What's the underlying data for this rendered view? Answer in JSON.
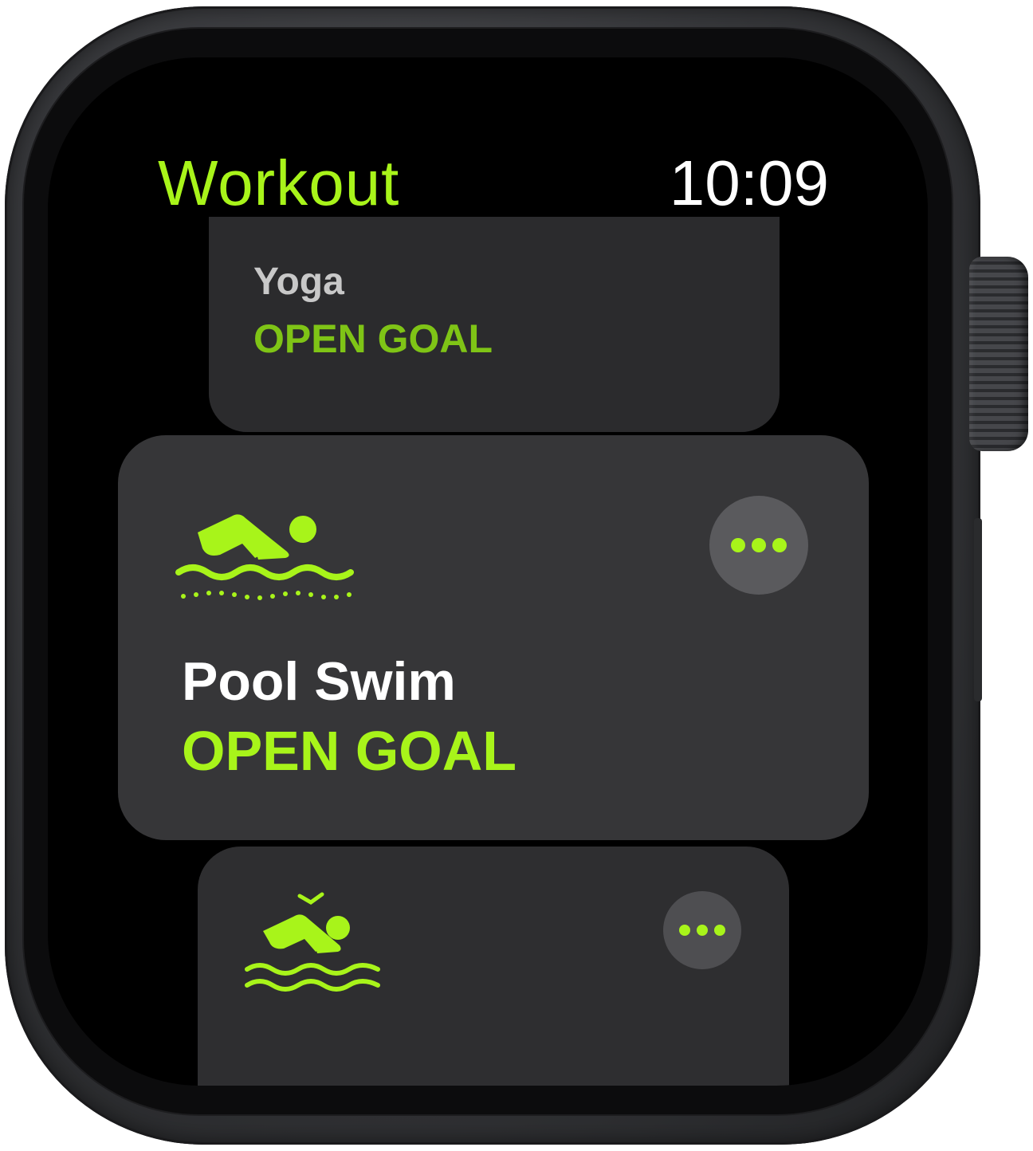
{
  "header": {
    "app_title": "Workout",
    "time": "10:09"
  },
  "workouts": [
    {
      "name": "Yoga",
      "goal": "OPEN GOAL",
      "icon": "yoga-icon"
    },
    {
      "name": "Pool Swim",
      "goal": "OPEN GOAL",
      "icon": "pool-swim-icon"
    },
    {
      "name": "",
      "goal": "",
      "icon": "open-water-swim-icon"
    }
  ],
  "colors": {
    "accent": "#a8f41a",
    "card_background": "#363638",
    "screen_background": "#000000"
  }
}
